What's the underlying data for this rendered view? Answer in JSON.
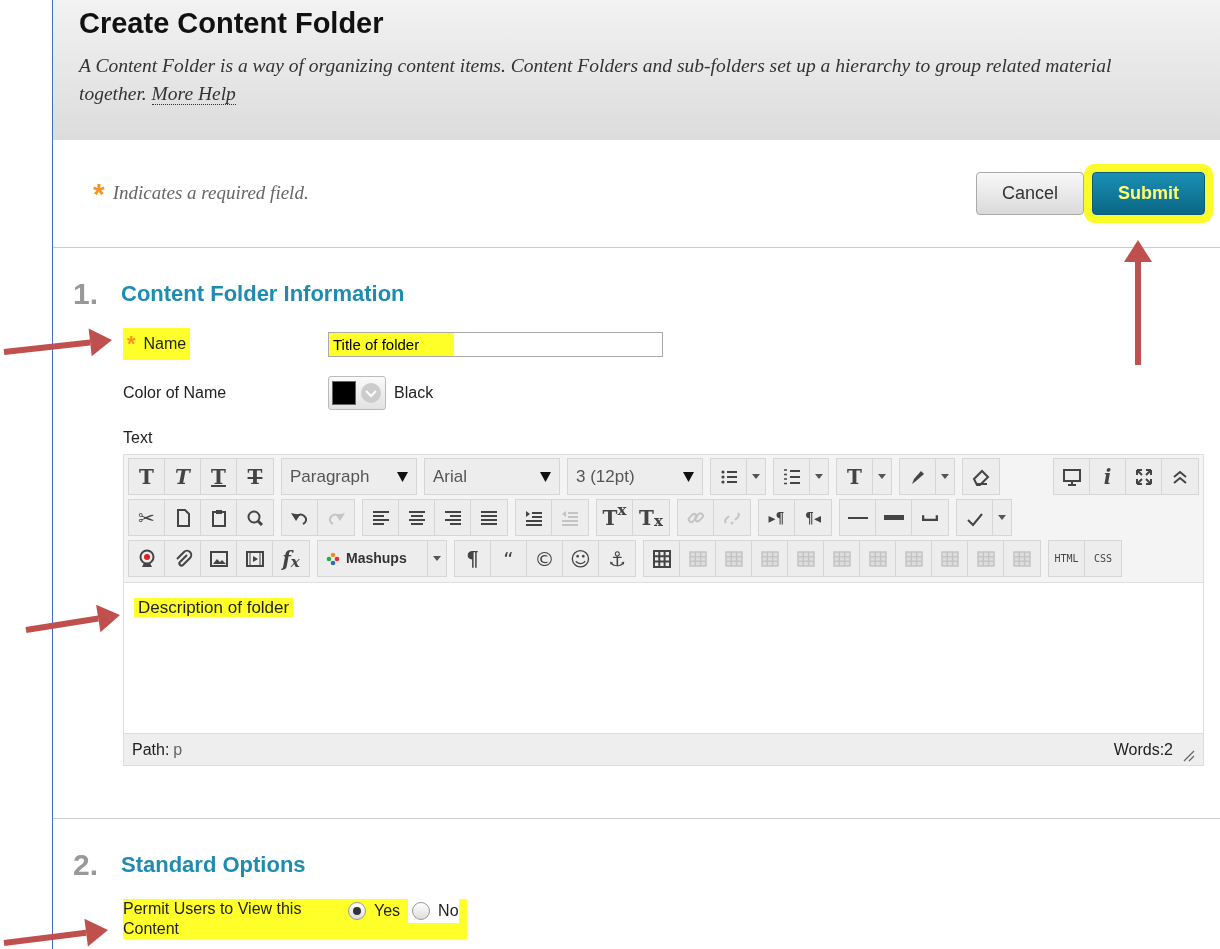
{
  "header": {
    "title": "Create Content Folder",
    "description": "A Content Folder is a way of organizing content items. Content Folders and sub-folders set up a hierarchy to group related material together.",
    "help_link": "More Help"
  },
  "required_note": {
    "marker": "*",
    "text": "Indicates a required field."
  },
  "buttons": [
    {
      "label": "Cancel",
      "kind": "secondary",
      "highlighted": false
    },
    {
      "label": "Submit",
      "kind": "primary",
      "highlighted": true
    }
  ],
  "sections": [
    {
      "number": "1.",
      "title": "Content Folder Information",
      "fields": [
        {
          "kind": "text",
          "label": "Name",
          "required": true,
          "required_marker": "*",
          "value": "Title of folder",
          "highlighted": true
        },
        {
          "kind": "color",
          "label": "Color of Name",
          "color": "#000000",
          "value": "Black"
        },
        {
          "kind": "editor",
          "label": "Text",
          "content": "Description of folder",
          "highlighted": true,
          "path_label": "Path:",
          "path_value": "p",
          "word_count": "Words:2",
          "toolbar": [
            [
              [
                {
                  "kind": "glyph",
                  "text": "T",
                  "disabled": false
                },
                {
                  "kind": "glyph",
                  "text": "T",
                  "disabled": false
                },
                {
                  "kind": "glyph",
                  "text": "T",
                  "disabled": false
                },
                {
                  "kind": "glyph",
                  "text": "T",
                  "disabled": false
                }
              ],
              [
                {
                  "kind": "select",
                  "text": "Paragraph"
                }
              ],
              [
                {
                  "kind": "select",
                  "text": "Arial"
                }
              ],
              [
                {
                  "kind": "select",
                  "text": "3 (12pt)"
                }
              ],
              [
                {
                  "kind": "icon",
                  "disabled": false
                },
                {
                  "kind": "caret"
                }
              ],
              [
                {
                  "kind": "icon",
                  "disabled": false
                },
                {
                  "kind": "caret"
                }
              ],
              [
                {
                  "kind": "glyph",
                  "text": "T",
                  "disabled": false
                },
                {
                  "kind": "caret"
                }
              ],
              [
                {
                  "kind": "icon",
                  "disabled": false
                },
                {
                  "kind": "caret"
                }
              ],
              [
                {
                  "kind": "icon",
                  "disabled": false
                }
              ],
              [
                {
                  "kind": "spacer"
                }
              ],
              [
                {
                  "kind": "icon",
                  "disabled": false
                },
                {
                  "kind": "glyph",
                  "text": "i",
                  "disabled": false
                },
                {
                  "kind": "icon",
                  "disabled": false
                },
                {
                  "kind": "icon",
                  "disabled": false
                }
              ]
            ],
            [
              [
                {
                  "kind": "glyph",
                  "text": "✂",
                  "disabled": false
                },
                {
                  "kind": "icon",
                  "disabled": false
                },
                {
                  "kind": "icon",
                  "disabled": false
                },
                {
                  "kind": "icon",
                  "disabled": false
                }
              ],
              [
                {
                  "kind": "icon",
                  "disabled": false
                },
                {
                  "kind": "icon",
                  "disabled": true
                }
              ],
              [
                {
                  "kind": "icon",
                  "disabled": false
                },
                {
                  "kind": "icon",
                  "disabled": false
                },
                {
                  "kind": "icon",
                  "disabled": false
                },
                {
                  "kind": "icon",
                  "disabled": false
                }
              ],
              [
                {
                  "kind": "icon",
                  "disabled": false
                },
                {
                  "kind": "icon",
                  "disabled": true
                }
              ],
              [
                {
                  "kind": "glyph",
                  "text": "T$^{x}$",
                  "disabled": false
                },
                {
                  "kind": "glyph",
                  "text": "T$_{x}$",
                  "disabled": false
                }
              ],
              [
                {
                  "kind": "icon",
                  "disabled": true
                },
                {
                  "kind": "icon",
                  "disabled": true
                }
              ],
              [
                {
                  "kind": "glyph",
                  "text": "▸¶",
                  "disabled": false
                },
                {
                  "kind": "glyph",
                  "text": "¶◂",
                  "disabled": false
                }
              ],
              [
                {
                  "kind": "icon",
                  "disabled": false
                },
                {
                  "kind": "icon",
                  "disabled": false
                },
                {
                  "kind": "icon",
                  "disabled": false
                }
              ],
              [
                {
                  "kind": "icon",
                  "disabled": false
                },
                {
                  "kind": "caret"
                }
              ]
            ],
            [
              [
                {
                  "kind": "icon",
                  "disabled": false
                },
                {
                  "kind": "icon",
                  "disabled": false
                },
                {
                  "kind": "icon",
                  "disabled": false
                },
                {
                  "kind": "icon",
                  "disabled": false
                },
                {
                  "kind": "glyph",
                  "text": "f$_{x}$",
                  "disabled": false
                }
              ],
              [
                {
                  "kind": "mashup",
                  "text": "Mashups"
                },
                {
                  "kind": "caret"
                }
              ],
              [
                {
                  "kind": "glyph",
                  "text": "¶",
                  "disabled": false
                },
                {
                  "kind": "glyph",
                  "text": "“",
                  "disabled": false
                },
                {
                  "kind": "glyph",
                  "text": "©",
                  "disabled": false
                },
                {
                  "kind": "glyph",
                  "text": "☺",
                  "disabled": false
                },
                {
                  "kind": "glyph",
                  "text": "⚓",
                  "disabled": false
                }
              ],
              [
                {
                  "kind": "icon",
                  "disabled": false
                },
                {
                  "kind": "icon",
                  "disabled": true
                },
                {
                  "kind": "icon",
                  "disabled": true
                },
                {
                  "kind": "icon",
                  "disabled": true
                },
                {
                  "kind": "icon",
                  "disabled": true
                },
                {
                  "kind": "icon",
                  "disabled": true
                },
                {
                  "kind": "icon",
                  "disabled": true
                },
                {
                  "kind": "icon",
                  "disabled": true
                },
                {
                  "kind": "icon",
                  "disabled": true
                },
                {
                  "kind": "icon",
                  "disabled": true
                },
                {
                  "kind": "icon",
                  "disabled": true
                }
              ],
              [
                {
                  "kind": "glyph",
                  "text": "HTML",
                  "disabled": false
                },
                {
                  "kind": "glyph",
                  "text": "CSS",
                  "disabled": false
                }
              ]
            ]
          ]
        }
      ]
    },
    {
      "number": "2.",
      "title": "Standard Options",
      "fields": [
        {
          "kind": "radio",
          "label": "Permit Users to View this Content",
          "highlighted": true,
          "options": [
            {
              "label": "Yes",
              "selected": true
            },
            {
              "label": "No",
              "selected": false
            }
          ]
        }
      ]
    }
  ]
}
